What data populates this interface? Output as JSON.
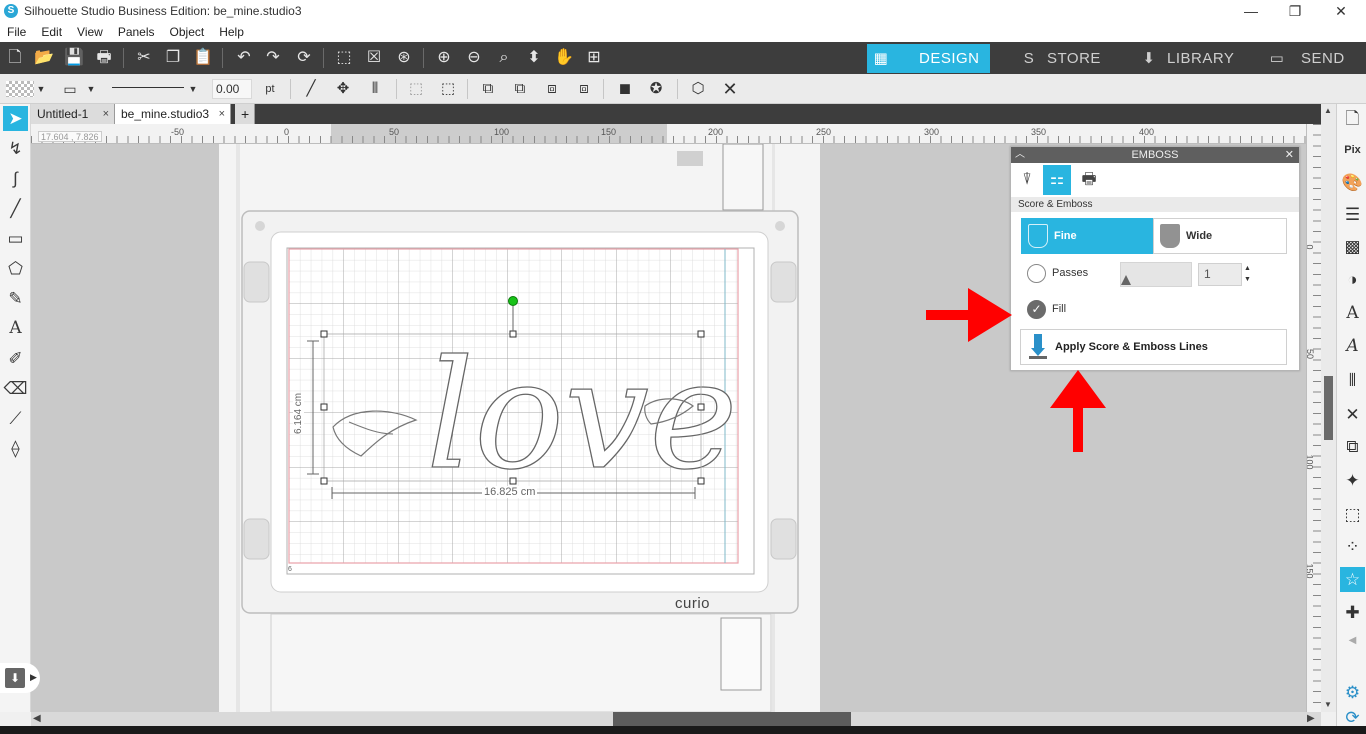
{
  "window": {
    "title": "Silhouette Studio Business Edition: be_mine.studio3",
    "minimize": "—",
    "restore": "❐",
    "close": "✕"
  },
  "menu": [
    "File",
    "Edit",
    "View",
    "Panels",
    "Object",
    "Help"
  ],
  "modes": {
    "design": "DESIGN",
    "store": "STORE",
    "library": "LIBRARY",
    "send": "SEND"
  },
  "line_settings": {
    "width_value": "0.00",
    "unit": "pt"
  },
  "tabs": {
    "items": [
      {
        "label": "Untitled-1",
        "close": "×"
      },
      {
        "label": "be_mine.studio3",
        "close": "×"
      }
    ],
    "add": "+"
  },
  "ruler": {
    "coords": "17.604 , 7.826",
    "h_labels": [
      "-50",
      "0",
      "50",
      "100",
      "150",
      "200",
      "250",
      "300",
      "350",
      "400"
    ],
    "v_labels": [
      "0",
      "50",
      "100",
      "150"
    ]
  },
  "canvas": {
    "design_text": "love",
    "height_dim": "6.164 cm",
    "width_dim": "16.825 cm",
    "cutter_brand": "curio",
    "mat_corner_label": "6"
  },
  "emboss_panel": {
    "title": "EMBOSS",
    "section": "Score & Emboss",
    "fine": "Fine",
    "wide": "Wide",
    "passes_label": "Passes",
    "passes_value": "1",
    "fill_label": "Fill",
    "apply_button": "Apply Score & Emboss Lines"
  },
  "colors": {
    "accent": "#29b5e0",
    "toolbar": "#3d3d3d",
    "annotation_arrow": "#ff0000",
    "mat_grid": "#e8a0a8"
  }
}
